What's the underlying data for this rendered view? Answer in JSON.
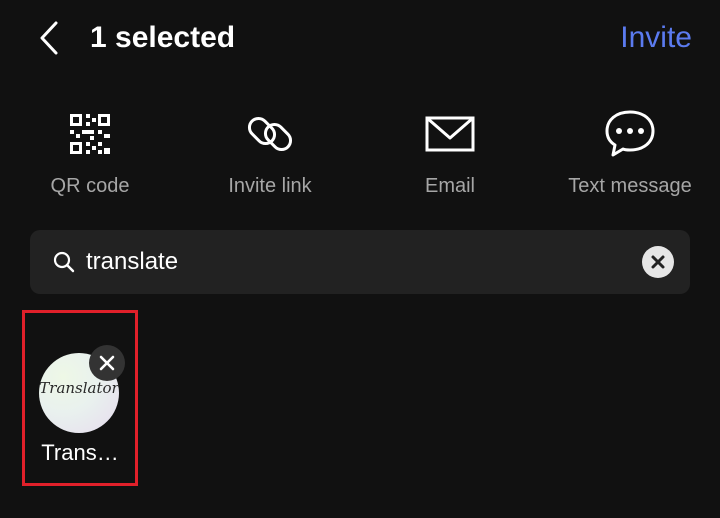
{
  "header": {
    "title": "1 selected",
    "invite_label": "Invite"
  },
  "options": [
    {
      "label": "QR code",
      "icon": "qr-code-icon"
    },
    {
      "label": "Invite link",
      "icon": "link-icon"
    },
    {
      "label": "Email",
      "icon": "envelope-icon"
    },
    {
      "label": "Text message",
      "icon": "chat-bubble-icon"
    }
  ],
  "search": {
    "value": "translate",
    "placeholder": ""
  },
  "selected": [
    {
      "name": "Trans…",
      "avatar_text": "Translator"
    }
  ],
  "colors": {
    "background": "#111111",
    "accent": "#5b7bf0",
    "highlight_border": "#e0202a",
    "search_bg": "#222222"
  }
}
